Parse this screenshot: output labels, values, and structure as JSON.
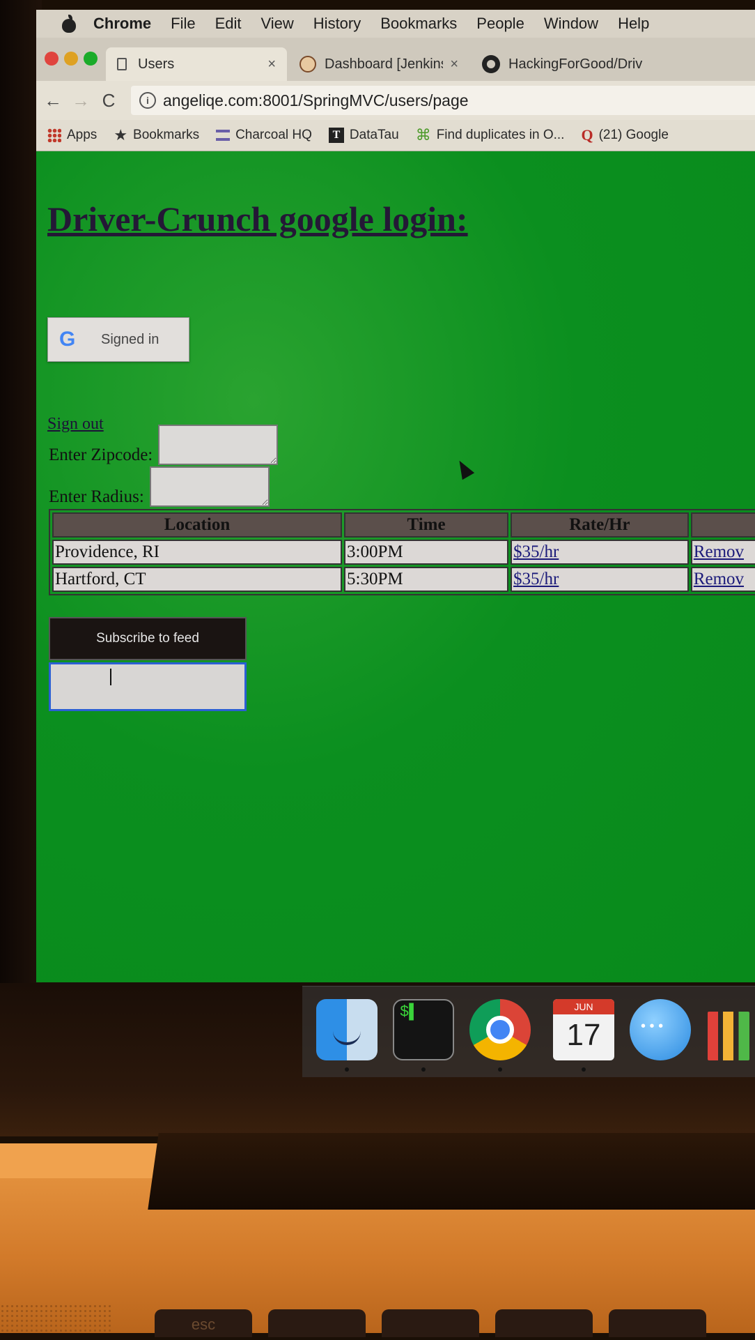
{
  "menubar": {
    "app_name": "Chrome",
    "items": [
      "File",
      "Edit",
      "View",
      "History",
      "Bookmarks",
      "People",
      "Window",
      "Help"
    ]
  },
  "tabs": [
    {
      "title": "Users",
      "close": "×"
    },
    {
      "title": "Dashboard [Jenkins]",
      "close": "×"
    },
    {
      "title": "HackingForGood/Driv"
    }
  ],
  "toolbar": {
    "back": "←",
    "forward": "→",
    "reload": "C",
    "url": "angeliqe.com:8001/SpringMVC/users/page"
  },
  "bookmarks": [
    {
      "label": "Apps",
      "icon": "apps-grid-icon"
    },
    {
      "label": "Bookmarks",
      "icon": "star-icon"
    },
    {
      "label": "Charcoal HQ",
      "icon": "charcoal-icon"
    },
    {
      "label": "DataTau",
      "icon": "datatau-icon"
    },
    {
      "label": "Find duplicates in O...",
      "icon": "duplicates-icon"
    },
    {
      "label": "(21) Google",
      "icon": "quora-icon"
    }
  ],
  "page": {
    "title": "Driver-Crunch google login:",
    "google_button_label": "Signed in",
    "google_logo": "G",
    "sign_out_label": "Sign out",
    "zipcode_label": "Enter Zipcode:",
    "radius_label": "Enter Radius:",
    "table": {
      "headers": [
        "Location",
        "Time",
        "Rate/Hr",
        ""
      ],
      "rows": [
        {
          "location": "Providence, RI",
          "time": "3:00PM",
          "rate": "$35/hr",
          "action": "Remov"
        },
        {
          "location": "Hartford, CT",
          "time": "5:30PM",
          "rate": "$35/hr",
          "action": "Remov"
        }
      ]
    },
    "subscribe_label": "Subscribe to feed"
  },
  "dock": {
    "terminal_prompt": "$",
    "calendar_month": "JUN",
    "calendar_day": "17"
  },
  "keyboard": {
    "esc_label": "esc"
  }
}
